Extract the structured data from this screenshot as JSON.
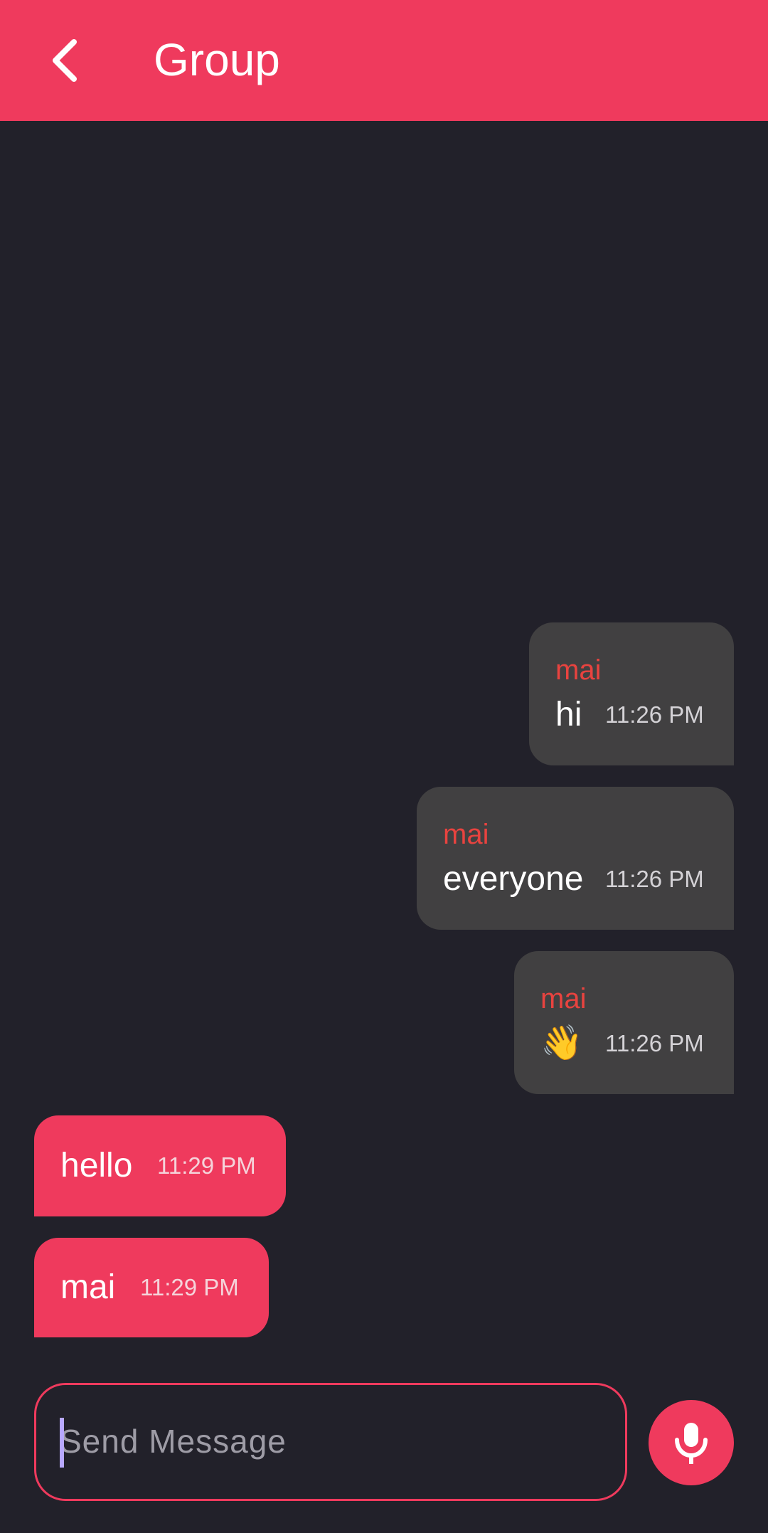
{
  "app_bar": {
    "title": "Group",
    "background_color": "#ef3a5d",
    "back_icon": "chevron-left-icon"
  },
  "messages": [
    {
      "direction": "incoming",
      "sender": "mai",
      "text": "hi",
      "time": "11:26 PM"
    },
    {
      "direction": "incoming",
      "sender": "mai",
      "text": "everyone",
      "time": "11:26 PM"
    },
    {
      "direction": "incoming",
      "sender": "mai",
      "text": "👋",
      "time": "11:26 PM"
    },
    {
      "direction": "outgoing",
      "text": "hello",
      "time": "11:29 PM"
    },
    {
      "direction": "outgoing",
      "text": "mai",
      "time": "11:29 PM"
    }
  ],
  "composer": {
    "placeholder": "Send Message",
    "value": "",
    "mic_icon": "microphone-icon"
  },
  "colors": {
    "accent": "#ef3a5d",
    "background": "#22212a",
    "incoming_bubble": "#414041",
    "sender_name": "#e8433f"
  }
}
